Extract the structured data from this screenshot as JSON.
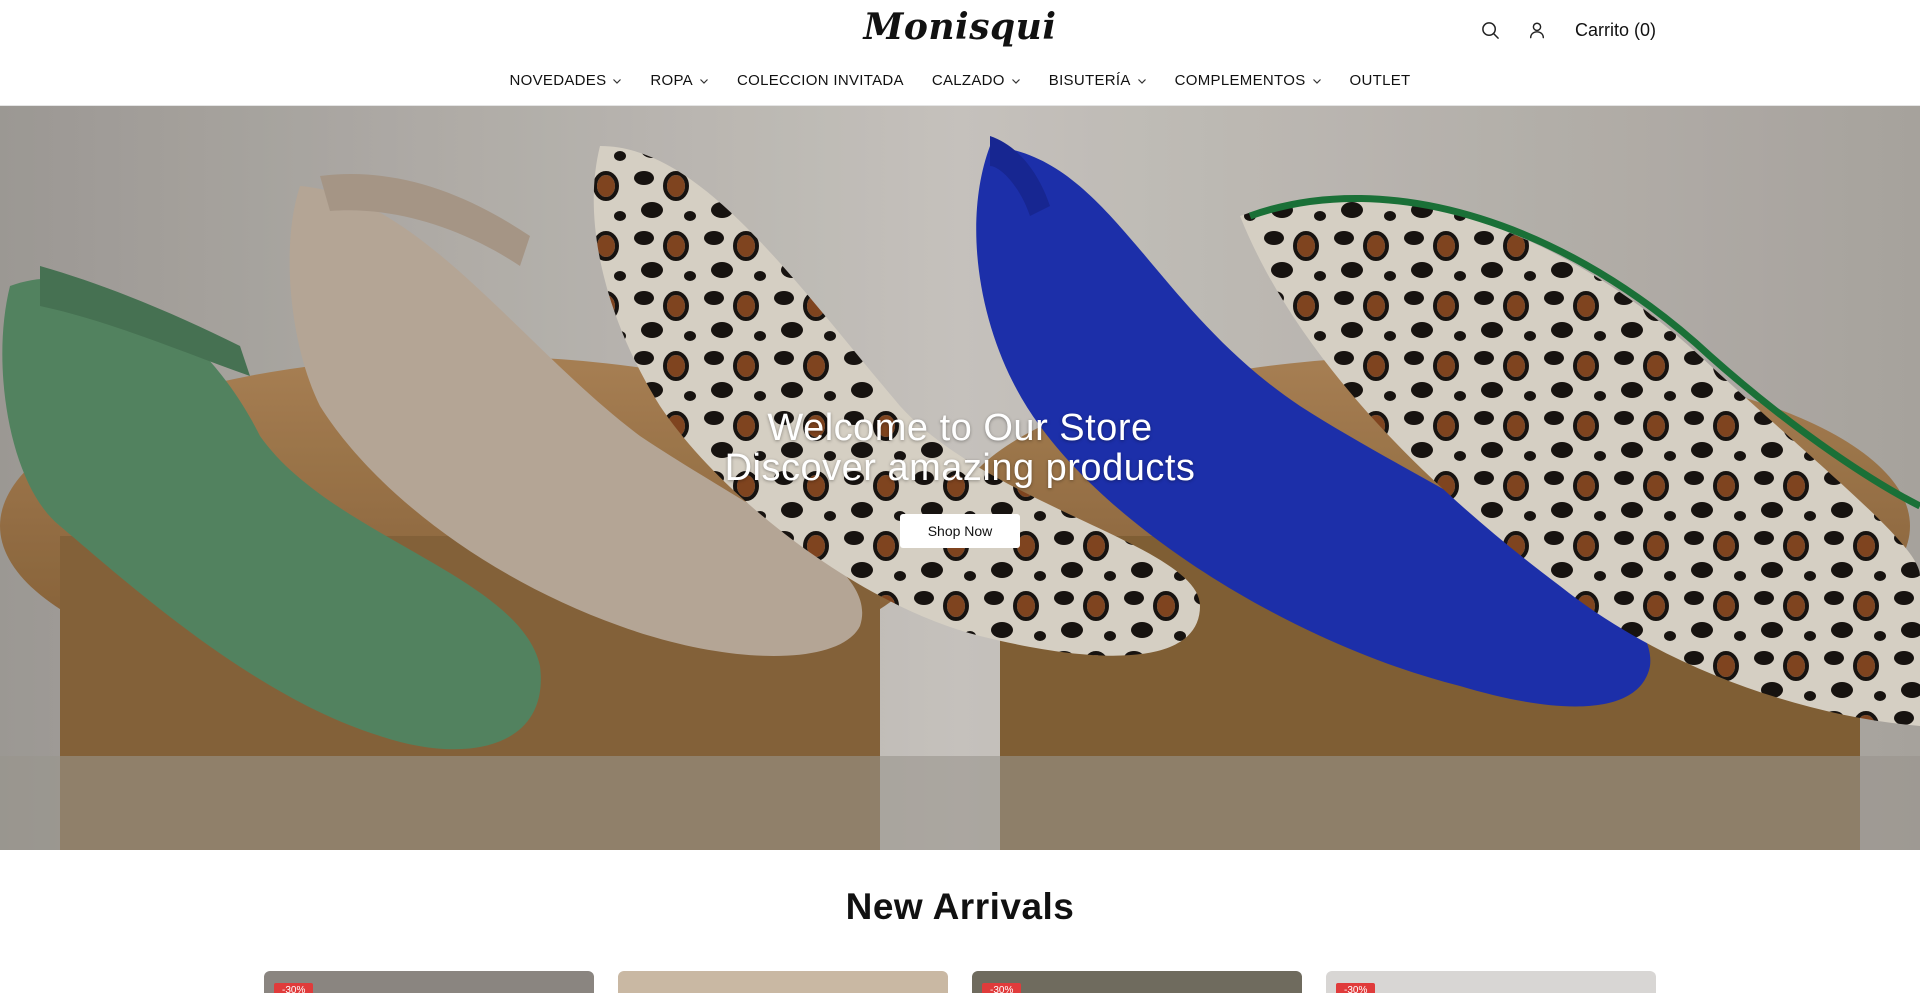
{
  "header": {
    "logo": "Monisqui",
    "cart_label": "Carrito (0)",
    "search_icon": "search-icon",
    "account_icon": "user-icon"
  },
  "nav": {
    "items": [
      {
        "label": "NOVEDADES",
        "has_dropdown": true
      },
      {
        "label": "ROPA",
        "has_dropdown": true
      },
      {
        "label": "COLECCION INVITADA",
        "has_dropdown": false
      },
      {
        "label": "CALZADO",
        "has_dropdown": true
      },
      {
        "label": "BISUTERÍA",
        "has_dropdown": true
      },
      {
        "label": "COMPLEMENTOS",
        "has_dropdown": true
      },
      {
        "label": "OUTLET",
        "has_dropdown": false
      }
    ]
  },
  "hero": {
    "title": "Welcome to Our Store",
    "subtitle": "Discover amazing products",
    "button_label": "Shop Now"
  },
  "new_arrivals": {
    "title": "New Arrivals",
    "products": [
      {
        "badge": "-30%",
        "bg": "#8a8580"
      },
      {
        "badge": "",
        "bg": "#c9b8a3"
      },
      {
        "badge": "-30%",
        "bg": "#6f6b5e"
      },
      {
        "badge": "-30%",
        "bg": "#d8d6d4"
      }
    ]
  },
  "colors": {
    "badge": "#e03b3b",
    "text": "#111111"
  }
}
